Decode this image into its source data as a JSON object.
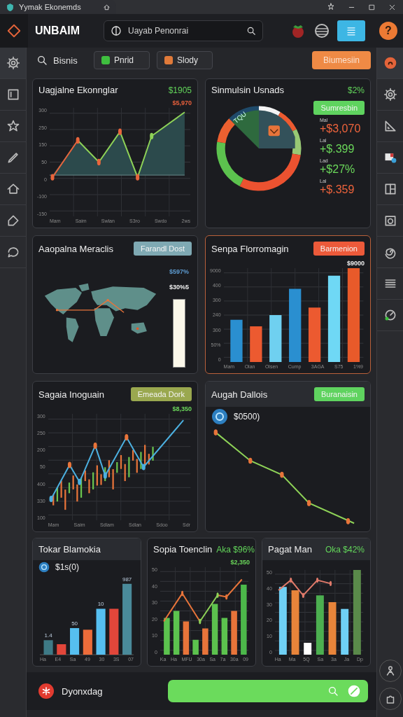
{
  "window": {
    "title": "Yymak Ekonemds"
  },
  "header": {
    "brand": "UNBAIM",
    "search": {
      "placeholder": "Uayab Penonrai"
    },
    "help": "?"
  },
  "toolbar": {
    "search_label": "Bisnis",
    "chips": [
      {
        "label": "Pnrid",
        "color": "#3fbf3f"
      },
      {
        "label": "Slody",
        "color": "#e07a3a"
      }
    ],
    "button": {
      "label": "Biumesiin",
      "color": "#ef8a45"
    }
  },
  "cards": [
    {
      "kind": "area_line",
      "title": "Uagjalne Ekonnglar",
      "value": "$1905",
      "highlighted": false,
      "banded": false,
      "notes": [
        {
          "text": "$5,970",
          "color": "#e8603c"
        }
      ],
      "y_labels": [
        "300",
        "250",
        "150",
        "50",
        "0",
        "-100",
        "-150"
      ],
      "x_labels": [
        "Mam",
        "Saim",
        "Swlan",
        "S3ro",
        "Swdo",
        "2ws"
      ]
    },
    {
      "kind": "donut",
      "title": "Sinmulsin Usnads",
      "value": "$2%",
      "highlighted": false,
      "banded": false,
      "button": {
        "label": "Sumresbin",
        "color": "#5fd35f"
      },
      "segment_label": "TQU",
      "stats": [
        {
          "label": "Mal",
          "value": "+$3,070",
          "color": "#f0643c"
        },
        {
          "label": "Lal",
          "value": "+$.399",
          "color": "#6bd85a"
        },
        {
          "label": "Lad",
          "value": "+$27%",
          "color": "#6bd85a"
        },
        {
          "label": "Lal",
          "value": "+$.359",
          "color": "#f0643c"
        }
      ]
    },
    {
      "kind": "map",
      "title": "Aaopalna Meraclis",
      "highlighted": false,
      "banded": false,
      "button": {
        "label": "Farandl Dost",
        "color": "#7fa9b3"
      },
      "notes": [
        {
          "text": "$597%",
          "color": "#5d9bd0"
        },
        {
          "text": "$30%5",
          "color": "#f0f0f0"
        }
      ]
    },
    {
      "kind": "bars",
      "title": "Senpa Florromagin",
      "highlighted": true,
      "banded": false,
      "button": {
        "label": "Barmenion",
        "color": "#ec5a3a"
      },
      "notes": [
        {
          "text": "$9000",
          "color": "#f0f0f0"
        }
      ],
      "y_labels": [
        "9000",
        "400",
        "300",
        "240",
        "300",
        "50%",
        "0"
      ],
      "x_labels": [
        "Mam",
        "Olan",
        "Olsen",
        "Cump",
        "3AGA",
        "S75",
        "1%9"
      ]
    },
    {
      "kind": "candles",
      "title": "Sagaia Inoguain",
      "highlighted": false,
      "banded": false,
      "button": {
        "label": "Emeada Dork",
        "color": "#9aa84f"
      },
      "notes": [
        {
          "text": "$8,350",
          "color": "#6bd85a"
        }
      ],
      "y_labels": [
        "300",
        "250",
        "200",
        "50",
        "400",
        "330",
        "100"
      ],
      "x_labels": [
        "Mam",
        "Saim",
        "Sdlam",
        "Sdlan",
        "Sdoo",
        "Sdr"
      ]
    },
    {
      "kind": "trend",
      "title": "Augah Dallois",
      "highlighted": false,
      "banded": true,
      "button": {
        "label": "Buranaisin",
        "color": "#5fd35f"
      },
      "lead": "$0500)"
    },
    {
      "kind": "bars_labeled",
      "title": "Tokar Blamokia",
      "highlighted": false,
      "banded": true,
      "lead": "$1s(0)",
      "bar_labels": [
        "1.4",
        "50",
        "10",
        "987"
      ],
      "x_labels": [
        "Ha",
        "E4",
        "Sa",
        "49",
        "30",
        "3S",
        "07"
      ]
    },
    {
      "kind": "bars_line",
      "title": "Sopia Toenclin",
      "value": "Aka $96%",
      "highlighted": false,
      "banded": false,
      "notes": [
        {
          "text": "$2,350",
          "color": "#6bd85a"
        }
      ],
      "y_labels": [
        "50",
        "40",
        "30",
        "20",
        "10",
        "0"
      ],
      "x_labels": [
        "Ka",
        "Ha",
        "MFU",
        "30a",
        "Sa",
        "7a",
        "30a",
        "09"
      ]
    },
    {
      "kind": "bars_line_b",
      "title": "Pagat Man",
      "value": "Oka $42%",
      "highlighted": false,
      "banded": true,
      "y_labels": [
        "50",
        "40",
        "30",
        "20",
        "10",
        "0"
      ],
      "x_labels": [
        "Ha",
        "Ma",
        "5Q",
        "Sa",
        "3a",
        "Ja",
        "Dp"
      ]
    }
  ],
  "footer": {
    "label": "Dyonxdag"
  }
}
